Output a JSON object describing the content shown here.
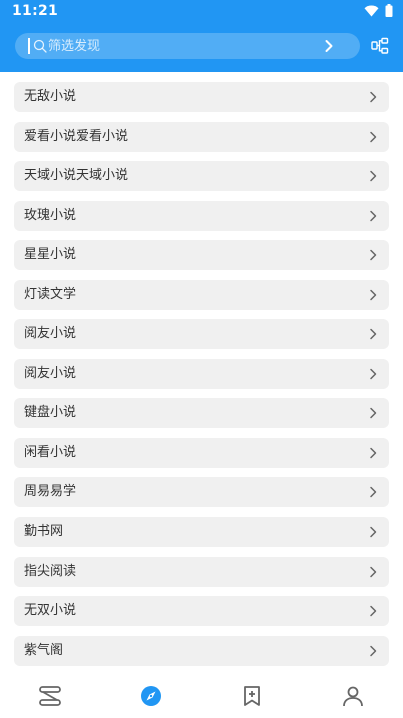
{
  "status_bar": {
    "time": "11:21"
  },
  "search": {
    "placeholder": "筛选发现"
  },
  "sources": [
    {
      "label": "无敌小说"
    },
    {
      "label": "爱看小说爱看小说"
    },
    {
      "label": "天域小说天域小说"
    },
    {
      "label": "玫瑰小说"
    },
    {
      "label": "星星小说"
    },
    {
      "label": "灯读文学"
    },
    {
      "label": "阅友小说"
    },
    {
      "label": "阅友小说"
    },
    {
      "label": "键盘小说"
    },
    {
      "label": "闲看小说"
    },
    {
      "label": "周易易学"
    },
    {
      "label": "勤书网"
    },
    {
      "label": "指尖阅读"
    },
    {
      "label": "无双小说"
    },
    {
      "label": "紫气阁"
    }
  ],
  "bottom_nav": {
    "active": "discover",
    "items": [
      "bookshelf-icon",
      "discover-compass-icon",
      "bookmark-add-icon",
      "profile-icon"
    ]
  },
  "colors": {
    "accent": "#2196f3",
    "item_bg": "#f0f0f0",
    "text": "#333333"
  }
}
